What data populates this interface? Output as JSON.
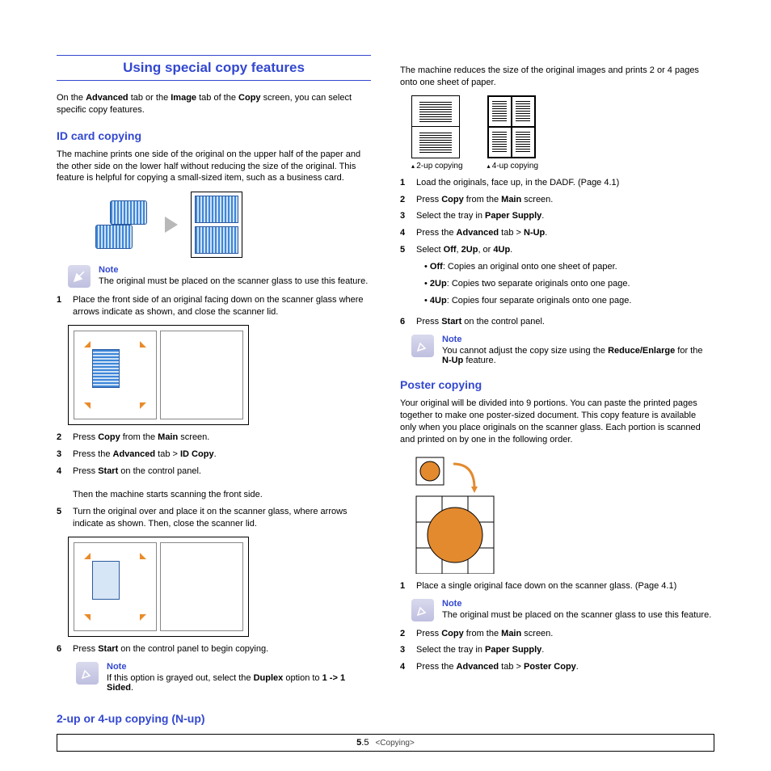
{
  "section_title": "Using special copy features",
  "intro_parts": [
    "On the ",
    "Advanced",
    " tab or the ",
    "Image",
    " tab of the ",
    "Copy",
    " screen, you can select specific copy features."
  ],
  "id_card": {
    "heading": "ID card copying",
    "para": "The machine prints one side of the original on the upper half of the paper and the other side on the lower half without reducing the size of the original. This feature is helpful for copying a small-sized item, such as a business card.",
    "note_label": "Note",
    "note_text": "The original must be placed on the scanner glass to use this feature.",
    "steps": {
      "s1": "Place the front side of an original facing down on the scanner glass where arrows indicate as shown, and close the scanner lid.",
      "s2_a": "Press ",
      "s2_b": "Copy",
      "s2_c": " from the ",
      "s2_d": "Main",
      "s2_e": " screen.",
      "s3_a": "Press the ",
      "s3_b": "Advanced",
      "s3_c": " tab > ",
      "s3_d": "ID Copy",
      "s3_e": ".",
      "s4_a": "Press ",
      "s4_b": "Start",
      "s4_c": " on the control panel.",
      "s4_extra": "Then the machine starts scanning the front side.",
      "s5": "Turn the original over and  place it on the scanner glass, where arrows indicate as shown. Then, close the scanner lid.",
      "s6_a": "Press ",
      "s6_b": "Start",
      "s6_c": " on the control panel to begin copying."
    },
    "note2_label": "Note",
    "note2_a": "If this option is grayed out, select the ",
    "note2_b": "Duplex",
    "note2_c": " option to ",
    "note2_d": "1 -> 1 Sided",
    "note2_e": "."
  },
  "nup": {
    "heading": "2-up or 4-up copying (N-up)",
    "intro": "The machine reduces the size of the original images and prints 2 or 4 pages onto one sheet of paper.",
    "cap2": "2-up copying",
    "cap4": "4-up copying",
    "steps": {
      "s1": "Load the originals, face up, in the DADF. (Page 4.1)",
      "s2_a": "Press ",
      "s2_b": "Copy",
      "s2_c": " from the ",
      "s2_d": "Main",
      "s2_e": " screen.",
      "s3_a": "Select the tray in ",
      "s3_b": "Paper Supply",
      "s3_c": ".",
      "s4_a": "Press the ",
      "s4_b": "Advanced",
      "s4_c": " tab > ",
      "s4_d": "N-Up",
      "s4_e": ".",
      "s5_a": "Select ",
      "s5_b": "Off",
      "s5_c": ", ",
      "s5_d": "2Up",
      "s5_e": ", or ",
      "s5_f": "4Up",
      "s5_g": ".",
      "b_off_a": "Off",
      "b_off_b": ": Copies an original onto one sheet of paper.",
      "b_2_a": "2Up",
      "b_2_b": ": Copies two separate originals onto one page.",
      "b_4_a": "4Up",
      "b_4_b": ": Copies four separate originals onto one page.",
      "s6_a": "Press ",
      "s6_b": "Start",
      "s6_c": " on the control panel."
    },
    "note_label": "Note",
    "note_a": "You cannot adjust the copy size using the ",
    "note_b": "Reduce/Enlarge",
    "note_c": " for the ",
    "note_d": "N-Up",
    "note_e": " feature."
  },
  "poster": {
    "heading": "Poster copying",
    "para": "Your original will be divided into 9 portions. You can paste the printed pages together to make one poster-sized document. This copy feature is available only when you place originals on the scanner glass. Each portion is scanned and printed on by one in the following order.",
    "steps": {
      "s1": "Place a single original face down on the scanner glass. (Page 4.1)",
      "s2_a": "Press ",
      "s2_b": "Copy",
      "s2_c": " from the ",
      "s2_d": "Main",
      "s2_e": " screen.",
      "s3_a": "Select the tray in ",
      "s3_b": "Paper Supply",
      "s3_c": ".",
      "s4_a": "Press the ",
      "s4_b": "Advanced",
      "s4_c": " tab > ",
      "s4_d": "Poster Copy",
      "s4_e": "."
    },
    "note_label": "Note",
    "note_text": "The original must be placed on the scanner glass to use this feature."
  },
  "footer": {
    "page": "5.5",
    "chapter": "<Copying>"
  }
}
